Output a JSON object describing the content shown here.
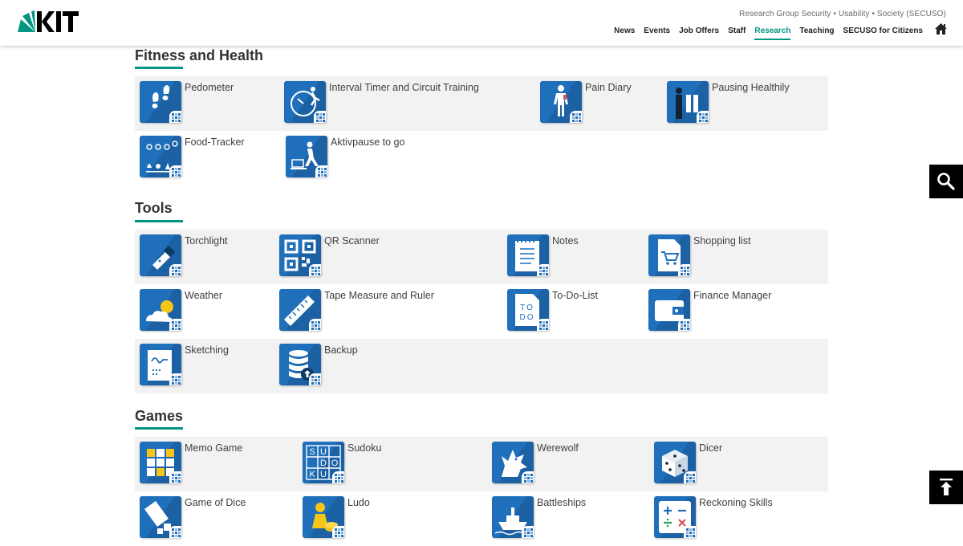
{
  "header": {
    "logo_text": "KIT",
    "group_name": "Research Group Security • Usability • Society (SECUSO)",
    "nav": [
      "News",
      "Events",
      "Job Offers",
      "Staff",
      "Research",
      "Teaching",
      "SECUSO for Citizens"
    ],
    "active_nav": "Research"
  },
  "colors": {
    "accent": "#009682",
    "icon_blue": "#1f6fba",
    "row_shade": "#f2f2f2"
  },
  "sections": [
    {
      "title": "Fitness and Health",
      "rows": [
        [
          {
            "label": "Pedometer",
            "icon": "footprints-icon"
          },
          {
            "label": "Interval Timer and Circuit Training",
            "icon": "stopwatch-runner-icon"
          },
          {
            "label": "Pain Diary",
            "icon": "body-figure-icon"
          },
          {
            "label": "Pausing Healthily",
            "icon": "pause-person-icon"
          }
        ],
        [
          {
            "label": "Food-Tracker",
            "icon": "food-items-icon"
          },
          {
            "label": "Aktivpause to go",
            "icon": "desk-exercise-icon"
          }
        ]
      ]
    },
    {
      "title": "Tools",
      "rows": [
        [
          {
            "label": "Torchlight",
            "icon": "flashlight-icon"
          },
          {
            "label": "QR Scanner",
            "icon": "qr-code-icon"
          },
          {
            "label": "Notes",
            "icon": "notepad-icon"
          },
          {
            "label": "Shopping list",
            "icon": "shopping-cart-icon"
          }
        ],
        [
          {
            "label": "Weather",
            "icon": "sun-cloud-icon"
          },
          {
            "label": "Tape Measure and Ruler",
            "icon": "ruler-icon"
          },
          {
            "label": "To-Do-List",
            "icon": "todo-icon"
          },
          {
            "label": "Finance Manager",
            "icon": "wallet-icon"
          }
        ],
        [
          {
            "label": "Sketching",
            "icon": "sketchpad-icon"
          },
          {
            "label": "Backup",
            "icon": "database-upload-icon"
          }
        ]
      ]
    },
    {
      "title": "Games",
      "rows": [
        [
          {
            "label": "Memo Game",
            "icon": "memo-grid-icon"
          },
          {
            "label": "Sudoku",
            "icon": "sudoku-grid-icon"
          },
          {
            "label": "Werewolf",
            "icon": "wolf-icon"
          },
          {
            "label": "Dicer",
            "icon": "die-icon"
          }
        ],
        [
          {
            "label": "Game of Dice",
            "icon": "dice-cup-icon"
          },
          {
            "label": "Ludo",
            "icon": "ludo-pawn-icon"
          },
          {
            "label": "Battleships",
            "icon": "battleship-icon"
          },
          {
            "label": "Reckoning Skills",
            "icon": "math-operators-icon"
          }
        ]
      ]
    }
  ],
  "qr_glyph": "▚▞",
  "todo_glyph": "TO DO",
  "sudoku_glyphs": [
    "S",
    "U",
    "D",
    "O",
    "K",
    "U"
  ],
  "floating": {
    "search_icon": "search-icon",
    "top_icon": "arrow-up-icon"
  }
}
